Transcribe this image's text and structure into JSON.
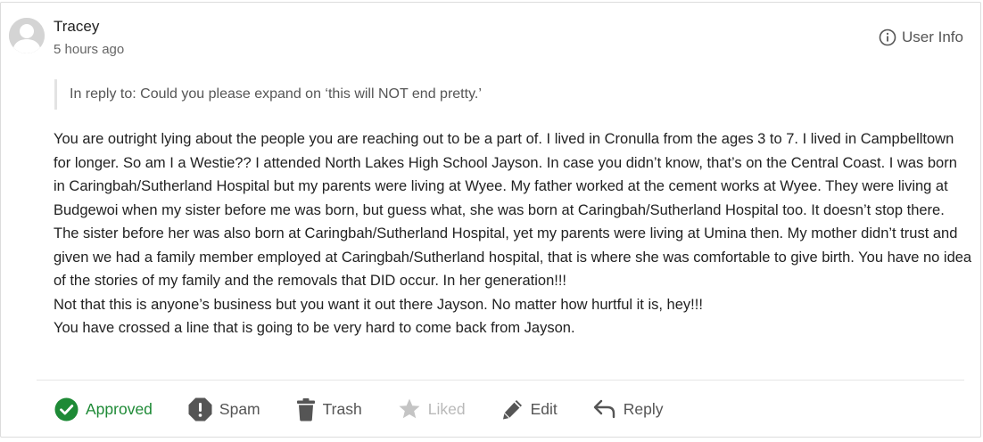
{
  "comment": {
    "author": "Tracey",
    "time": "5 hours ago",
    "user_info_label": "User Info",
    "reply_to": "In reply to: Could you please expand on ‘this will NOT end pretty.’",
    "paragraphs": [
      "You are outright lying about the people you are reaching out to be a part of. I lived in Cronulla from the ages 3 to 7. I lived in Campbelltown for longer. So am I a Westie?? I attended North Lakes High School Jayson. In case you didn’t know, that’s on the Central Coast. I was born in Caringbah/Sutherland Hospital but my parents were living at Wyee. My father worked at the cement works at Wyee. They were living at Budgewoi when my sister before me was born, but guess what, she was born at Caringbah/Sutherland Hospital too. It doesn’t stop there. The sister before her was also born at Caringbah/Sutherland Hospital, yet my parents were living at Umina then. My mother didn’t trust and given we had a family member employed at Caringbah/Sutherland hospital, that is where she was comfortable to give birth. You have no idea of the stories of my family and the removals that DID occur. In her generation!!!",
      "Not that this is anyone’s business but you want it out there Jayson. No matter how hurtful it is, hey!!!",
      "You have crossed a line that is going to be very hard to come back from Jayson."
    ]
  },
  "actions": {
    "approved": "Approved",
    "spam": "Spam",
    "trash": "Trash",
    "liked": "Liked",
    "edit": "Edit",
    "reply": "Reply"
  },
  "icons": {
    "avatar": "default-avatar-icon",
    "user_info": "info-circle-icon",
    "approved": "check-circle-icon",
    "spam": "alert-octagon-icon",
    "trash": "trash-icon",
    "liked": "star-icon",
    "edit": "pencil-icon",
    "reply": "reply-arrow-icon"
  },
  "colors": {
    "approved": "#1e8a36",
    "liked": "#b9b9b9",
    "text": "#222222"
  }
}
